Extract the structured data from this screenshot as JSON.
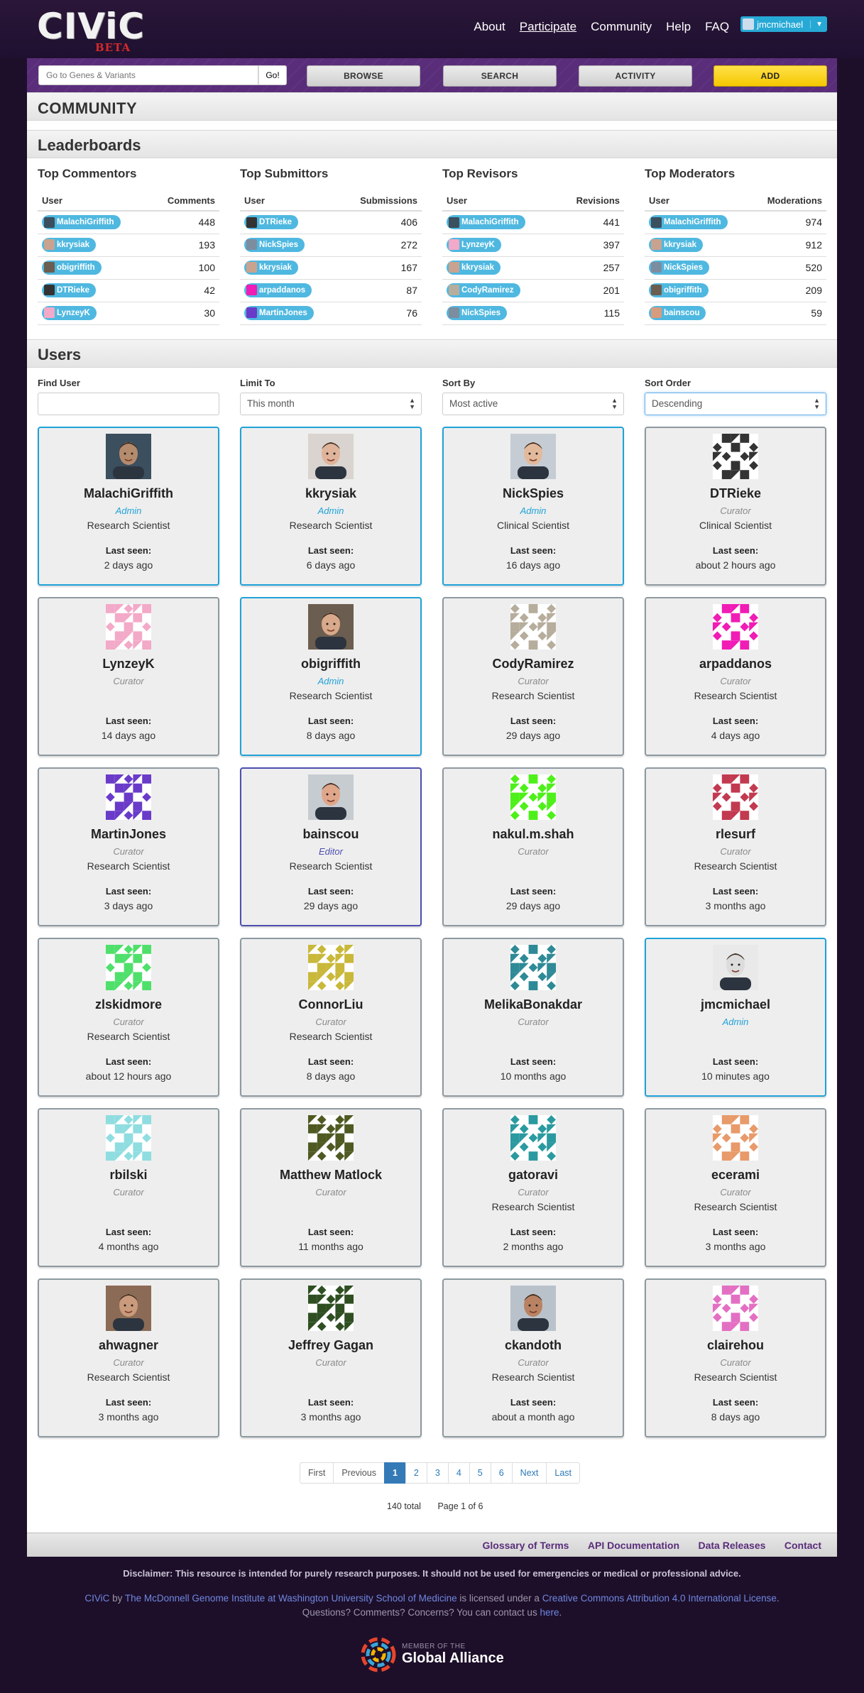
{
  "brand": {
    "name": "CIViC",
    "tag": "BETA"
  },
  "topnav": {
    "items": [
      "About",
      "Participate",
      "Community",
      "Help",
      "FAQ"
    ],
    "user": "jmcmichael"
  },
  "searchbar": {
    "placeholder": "Go to Genes & Variants",
    "go": "Go!",
    "buttons": [
      "BROWSE",
      "SEARCH",
      "ACTIVITY",
      "ADD"
    ]
  },
  "page": {
    "title": "COMMUNITY",
    "leaderboards_title": "Leaderboards",
    "users_title": "Users"
  },
  "leaderboards": [
    {
      "title": "Top Commentors",
      "col_user": "User",
      "col_value": "Comments",
      "rows": [
        {
          "user": "MalachiGriffith",
          "value": "448",
          "color": "#3b4f5e"
        },
        {
          "user": "kkrysiak",
          "value": "193",
          "color": "#c9a38f"
        },
        {
          "user": "obigriffith",
          "value": "100",
          "color": "#6b5d4f"
        },
        {
          "user": "DTRieke",
          "value": "42",
          "color": "#333333"
        },
        {
          "user": "LynzeyK",
          "value": "30",
          "color": "#f3a9c8"
        }
      ]
    },
    {
      "title": "Top Submittors",
      "col_user": "User",
      "col_value": "Submissions",
      "rows": [
        {
          "user": "DTRieke",
          "value": "406",
          "color": "#333333"
        },
        {
          "user": "NickSpies",
          "value": "272",
          "color": "#7d8da0"
        },
        {
          "user": "kkrysiak",
          "value": "167",
          "color": "#c9a38f"
        },
        {
          "user": "arpaddanos",
          "value": "87",
          "color": "#f11bb5"
        },
        {
          "user": "MartinJones",
          "value": "76",
          "color": "#6a3bc9"
        }
      ]
    },
    {
      "title": "Top Revisors",
      "col_user": "User",
      "col_value": "Revisions",
      "rows": [
        {
          "user": "MalachiGriffith",
          "value": "441",
          "color": "#3b4f5e"
        },
        {
          "user": "LynzeyK",
          "value": "397",
          "color": "#f3a9c8"
        },
        {
          "user": "kkrysiak",
          "value": "257",
          "color": "#c9a38f"
        },
        {
          "user": "CodyRamirez",
          "value": "201",
          "color": "#b7ad9c"
        },
        {
          "user": "NickSpies",
          "value": "115",
          "color": "#7d8da0"
        }
      ]
    },
    {
      "title": "Top Moderators",
      "col_user": "User",
      "col_value": "Moderations",
      "rows": [
        {
          "user": "MalachiGriffith",
          "value": "974",
          "color": "#3b4f5e"
        },
        {
          "user": "kkrysiak",
          "value": "912",
          "color": "#c9a38f"
        },
        {
          "user": "NickSpies",
          "value": "520",
          "color": "#7d8da0"
        },
        {
          "user": "obigriffith",
          "value": "209",
          "color": "#6b5d4f"
        },
        {
          "user": "bainscou",
          "value": "59",
          "color": "#d79b7e"
        }
      ]
    }
  ],
  "filters": {
    "find_label": "Find User",
    "find_value": "",
    "limit_label": "Limit To",
    "limit_value": "This month",
    "sort_label": "Sort By",
    "sort_value": "Most active",
    "order_label": "Sort Order",
    "order_value": "Descending"
  },
  "users": [
    {
      "name": "MalachiGriffith",
      "role": "Admin",
      "area": "Research Scientist",
      "seen": "2 days ago",
      "avatar": "photo",
      "color": "#3b4f5e",
      "skin": "#b58b6d"
    },
    {
      "name": "kkrysiak",
      "role": "Admin",
      "area": "Research Scientist",
      "seen": "6 days ago",
      "avatar": "photo",
      "color": "#d9d4cf",
      "skin": "#e0b49a"
    },
    {
      "name": "NickSpies",
      "role": "Admin",
      "area": "Clinical Scientist",
      "seen": "16 days ago",
      "avatar": "photo",
      "color": "#c6ccd4",
      "skin": "#e3b99c"
    },
    {
      "name": "DTRieke",
      "role": "Curator",
      "area": "Clinical Scientist",
      "seen": "about 2 hours ago",
      "avatar": "pattern",
      "color": "#333333"
    },
    {
      "name": "LynzeyK",
      "role": "Curator",
      "area": "",
      "seen": "14 days ago",
      "avatar": "pattern",
      "color": "#f3a9c8"
    },
    {
      "name": "obigriffith",
      "role": "Admin",
      "area": "Research Scientist",
      "seen": "8 days ago",
      "avatar": "photo",
      "color": "#6b5d4f",
      "skin": "#d8a98b"
    },
    {
      "name": "CodyRamirez",
      "role": "Curator",
      "area": "Research Scientist",
      "seen": "29 days ago",
      "avatar": "pattern",
      "color": "#b7ad9c"
    },
    {
      "name": "arpaddanos",
      "role": "Curator",
      "area": "Research Scientist",
      "seen": "4 days ago",
      "avatar": "pattern",
      "color": "#f11bb5"
    },
    {
      "name": "MartinJones",
      "role": "Curator",
      "area": "Research Scientist",
      "seen": "3 days ago",
      "avatar": "pattern",
      "color": "#6a3bc9"
    },
    {
      "name": "bainscou",
      "role": "Editor",
      "area": "Research Scientist",
      "seen": "29 days ago",
      "avatar": "photo",
      "color": "#c7ccd1",
      "skin": "#e0a68a"
    },
    {
      "name": "nakul.m.shah",
      "role": "Curator",
      "area": "",
      "seen": "29 days ago",
      "avatar": "pattern",
      "color": "#4ef01a"
    },
    {
      "name": "rlesurf",
      "role": "Curator",
      "area": "Research Scientist",
      "seen": "3 months ago",
      "avatar": "pattern",
      "color": "#c23a50"
    },
    {
      "name": "zlskidmore",
      "role": "Curator",
      "area": "Research Scientist",
      "seen": "about 12 hours ago",
      "avatar": "pattern",
      "color": "#4fe06b"
    },
    {
      "name": "ConnorLiu",
      "role": "Curator",
      "area": "Research Scientist",
      "seen": "8 days ago",
      "avatar": "pattern",
      "color": "#c9b83a"
    },
    {
      "name": "MelikaBonakdar",
      "role": "Curator",
      "area": "",
      "seen": "10 months ago",
      "avatar": "pattern",
      "color": "#2e8a96"
    },
    {
      "name": "jmcmichael",
      "role": "Admin",
      "area": "",
      "seen": "10 minutes ago",
      "avatar": "photo",
      "color": "#e9e9e9",
      "skin": "#dcdcdc"
    },
    {
      "name": "rbilski",
      "role": "Curator",
      "area": "",
      "seen": "4 months ago",
      "avatar": "pattern",
      "color": "#8fdde0"
    },
    {
      "name": "Matthew Matlock",
      "role": "Curator",
      "area": "",
      "seen": "11 months ago",
      "avatar": "pattern",
      "color": "#4e5a22"
    },
    {
      "name": "gatoravi",
      "role": "Curator",
      "area": "Research Scientist",
      "seen": "2 months ago",
      "avatar": "pattern",
      "color": "#2a9aa0"
    },
    {
      "name": "ecerami",
      "role": "Curator",
      "area": "Research Scientist",
      "seen": "3 months ago",
      "avatar": "pattern",
      "color": "#e89a6a"
    },
    {
      "name": "ahwagner",
      "role": "Curator",
      "area": "Research Scientist",
      "seen": "3 months ago",
      "avatar": "photo",
      "color": "#8b6b55",
      "skin": "#c99a7b"
    },
    {
      "name": "Jeffrey Gagan",
      "role": "Curator",
      "area": "",
      "seen": "3 months ago",
      "avatar": "pattern",
      "color": "#2f4f22"
    },
    {
      "name": "ckandoth",
      "role": "Curator",
      "area": "Research Scientist",
      "seen": "about a month ago",
      "avatar": "photo",
      "color": "#b9c2cb",
      "skin": "#b98262"
    },
    {
      "name": "clairehou",
      "role": "Curator",
      "area": "Research Scientist",
      "seen": "8 days ago",
      "avatar": "pattern",
      "color": "#e36fc3"
    }
  ],
  "last_seen_label": "Last seen:",
  "pagination": {
    "first": "First",
    "previous": "Previous",
    "pages": [
      "1",
      "2",
      "3",
      "4",
      "5",
      "6"
    ],
    "current": "1",
    "next": "Next",
    "last": "Last"
  },
  "totals": {
    "total": "140 total",
    "page": "Page 1 of 6"
  },
  "footer": {
    "links": [
      "Glossary of Terms",
      "API Documentation",
      "Data Releases",
      "Contact"
    ],
    "disclaimer": "Disclaimer: This resource is intended for purely research purposes. It should not be used for emergencies or medical or professional advice.",
    "license_parts": [
      "CIViC",
      " by ",
      "The McDonnell Genome Institute at Washington University School of Medicine",
      " is licensed under a ",
      "Creative Commons Attribution 4.0 International License",
      "."
    ],
    "contact_line": "Questions? Comments? Concerns? You can contact us ",
    "contact_link": "here",
    "ga_small": "MEMBER OF THE",
    "ga_big": "Global Alliance"
  }
}
